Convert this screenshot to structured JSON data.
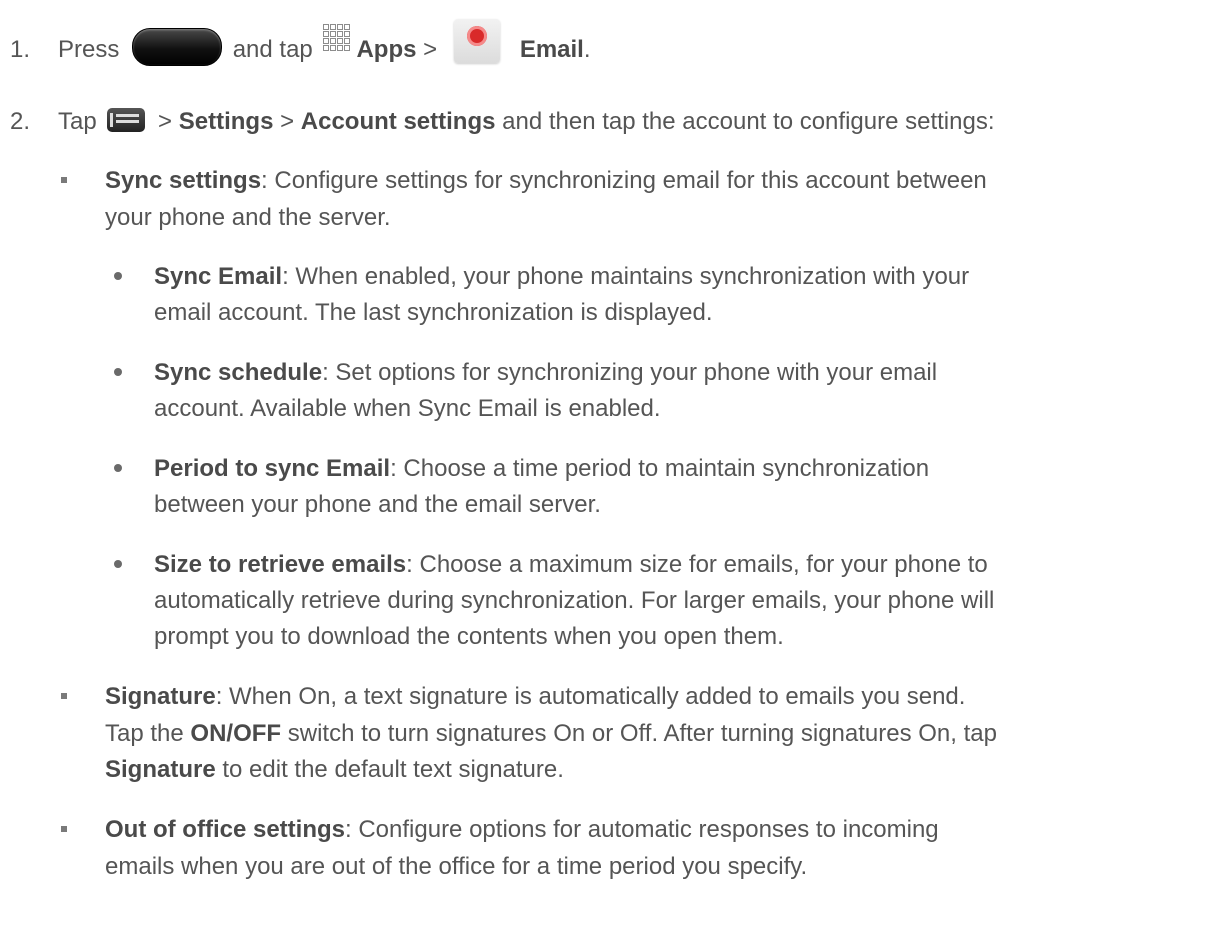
{
  "step1": {
    "number": "1.",
    "press": "Press",
    "and_tap": "and tap",
    "apps": "Apps",
    "sep": ">",
    "email": "Email",
    "period": "."
  },
  "step2": {
    "number": "2.",
    "tap": "Tap",
    "sep1": ">",
    "settings": "Settings",
    "sep2": ">",
    "account_settings": "Account settings",
    "rest": "and then tap the account to configure settings:"
  },
  "items": [
    {
      "term": "Sync settings",
      "lines": [
        "Configure  settings for synchronizing email for this account between",
        "your phone and the server."
      ],
      "sub": [
        {
          "term": "Sync Email",
          "lines": [
            "When enabled, your phone maintains synchronization with your",
            "email account. The last synchronization is displayed."
          ]
        },
        {
          "term": "Sync schedule",
          "lines": [
            "Set options for synchronizing your phone with your email",
            "account. Available when Sync Email is enabled."
          ]
        },
        {
          "term": "Period to sync Email",
          "lines": [
            "Choose a time period to maintain synchronization",
            "between your phone and the email server."
          ]
        },
        {
          "term": "Size to retrieve emails",
          "lines": [
            "Choose a maximum size for emails, for your phone to",
            "automatically retrieve during synchronization. For larger emails, your phone will",
            "prompt you to download the contents when you open them."
          ]
        }
      ]
    },
    {
      "term": "Signature",
      "lines": [
        "When On, a text signature is automatically added to emails you send.",
        "switch to turn signatures On or Off. After turning signatures On, tap",
        "to edit the default text signature."
      ],
      "tap_the": "Tap the",
      "onoff": "ON/OFF",
      "signature_word": "Signature"
    },
    {
      "term": "Out of office settings",
      "lines": [
        "Configure options for automatic responses to incoming",
        "emails when you are out of the office for a time period you specify."
      ]
    }
  ],
  "colon": ":"
}
